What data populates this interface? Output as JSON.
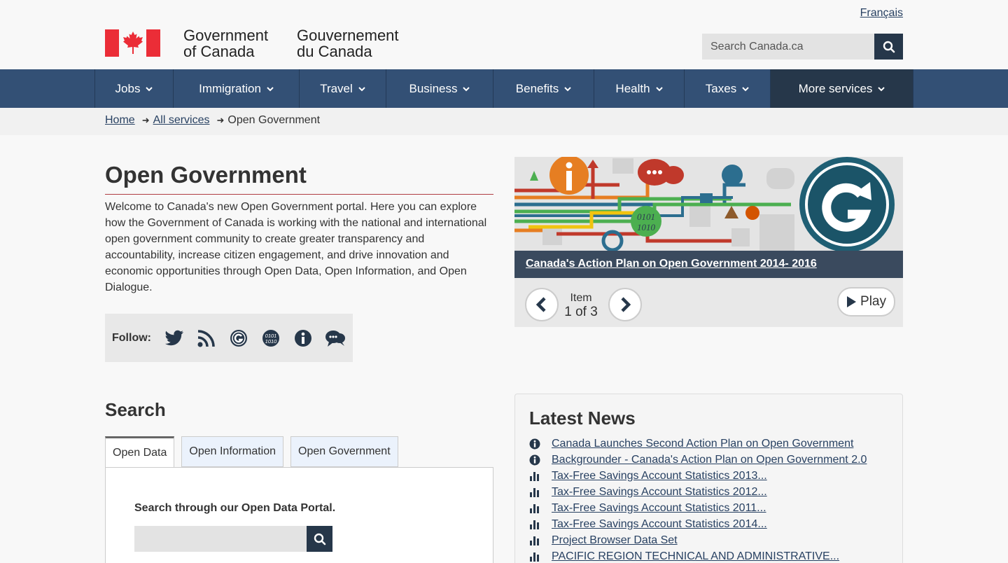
{
  "header": {
    "lang_link": "Français",
    "wordmark_en_line1": "Government",
    "wordmark_en_line2": "of Canada",
    "wordmark_fr_line1": "Gouvernement",
    "wordmark_fr_line2": "du Canada",
    "search_placeholder": "Search Canada.ca",
    "search_icon": "search-icon",
    "flag_icon": "canada-flag-icon"
  },
  "nav": {
    "items": [
      {
        "label": "Jobs"
      },
      {
        "label": "Immigration"
      },
      {
        "label": "Travel"
      },
      {
        "label": "Business"
      },
      {
        "label": "Benefits"
      },
      {
        "label": "Health"
      },
      {
        "label": "Taxes"
      },
      {
        "label": "More services"
      }
    ]
  },
  "breadcrumb": {
    "home": "Home",
    "all_services": "All services",
    "current": "Open Government"
  },
  "main": {
    "title": "Open Government",
    "intro": "Welcome to Canada's new Open Government portal. Here you can explore how the Government of Canada is working with the national and international open government community to create greater transparency and accountability, increase citizen engagement, and drive innovation and economic opportunities through Open Data, Open Information, and Open Dialogue.",
    "follow_label": "Follow:",
    "follow_icons": [
      "twitter-icon",
      "rss-icon",
      "open-government-icon",
      "open-data-icon",
      "open-information-icon",
      "open-dialogue-icon"
    ]
  },
  "carousel": {
    "caption": "Canada's Action Plan on Open Government 2014- 2016",
    "item_label": "Item",
    "counter": "1 of 3",
    "play_label": "Play"
  },
  "search_section": {
    "heading": "Search",
    "tabs": [
      {
        "label": "Open Data"
      },
      {
        "label": "Open Information"
      },
      {
        "label": "Open Government"
      }
    ],
    "panel_title": "Search through our Open Data Portal."
  },
  "news": {
    "heading": "Latest News",
    "items": [
      {
        "icon": "info-icon",
        "label": "Canada Launches Second Action Plan on Open Government"
      },
      {
        "icon": "info-icon",
        "label": "Backgrounder - Canada's Action Plan on Open Government 2.0"
      },
      {
        "icon": "bar-chart-icon",
        "label": "Tax-Free Savings Account Statistics 2013..."
      },
      {
        "icon": "bar-chart-icon",
        "label": "Tax-Free Savings Account Statistics 2012..."
      },
      {
        "icon": "bar-chart-icon",
        "label": "Tax-Free Savings Account Statistics 2011..."
      },
      {
        "icon": "bar-chart-icon",
        "label": "Tax-Free Savings Account Statistics 2014..."
      },
      {
        "icon": "bar-chart-icon",
        "label": "Project Browser Data Set"
      },
      {
        "icon": "bar-chart-icon",
        "label": "PACIFIC REGION TECHNICAL AND ADMINISTRATIVE..."
      }
    ]
  },
  "colors": {
    "nav_bg": "#335075",
    "nav_active": "#26374a",
    "flag_red": "#eb2d37",
    "link": "#284162",
    "title_rule": "#af3c43"
  }
}
